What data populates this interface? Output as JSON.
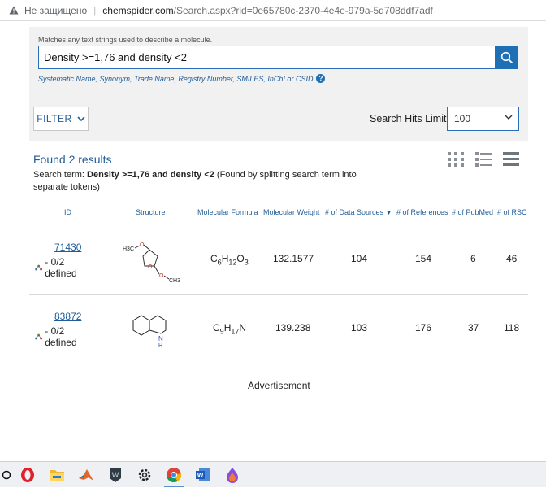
{
  "address_bar": {
    "insecure_label": "Не защищено",
    "host": "chemspider.com",
    "path": "/Search.aspx?rid=0e65780c-2370-4e4e-979a-5d708ddf7adf"
  },
  "search": {
    "hint": "Matches any text strings used to describe a molecule.",
    "value": "Density >=1,76 and density <2",
    "subhint": "Systematic Name, Synonym, Trade Name, Registry Number, SMILES, InChI or CSID",
    "help_label": "?"
  },
  "filter": {
    "label": "FILTER"
  },
  "hits": {
    "label": "Search Hits Limit:",
    "value": "100"
  },
  "results": {
    "found_text": "Found 2 results",
    "term_prefix": "Search term: ",
    "term_value": "Density >=1,76 and density <2",
    "term_suffix": " (Found by splitting search term into separate tokens)"
  },
  "columns": {
    "id": "ID",
    "structure": "Structure",
    "formula": "Molecular Formula",
    "weight": "Molecular Weight",
    "sources": "# of Data Sources",
    "references": "# of References",
    "pubmed": "# of PubMed",
    "rsc": "# of RSC"
  },
  "rows": [
    {
      "id": "71430",
      "defined": "- 0/2 defined",
      "formula_parts": [
        "C",
        "6",
        "H",
        "12",
        "O",
        "3"
      ],
      "weight": "132.1577",
      "sources": "104",
      "references": "154",
      "pubmed": "6",
      "rsc": "46",
      "structure_labels": {
        "left": "H3C",
        "right": "CH3",
        "ring_o": "O"
      }
    },
    {
      "id": "83872",
      "defined": "- 0/2 defined",
      "formula_parts": [
        "C",
        "9",
        "H",
        "17",
        "N",
        "",
        "",
        ""
      ],
      "weight": "139.238",
      "sources": "103",
      "references": "176",
      "pubmed": "37",
      "rsc": "118",
      "structure_labels": {
        "n": "N",
        "h": "H"
      }
    }
  ],
  "advertisement": "Advertisement",
  "taskbar": {
    "items": [
      "search-icon",
      "opera-icon",
      "file-explorer-icon",
      "matlab-icon",
      "game-app-icon",
      "settings-icon",
      "chrome-icon",
      "word-icon",
      "paint-app-icon"
    ],
    "active": "chrome-icon"
  },
  "colors": {
    "link": "#1f5c99",
    "accent": "#1f6fb5",
    "panel": "#f1f1f1"
  }
}
